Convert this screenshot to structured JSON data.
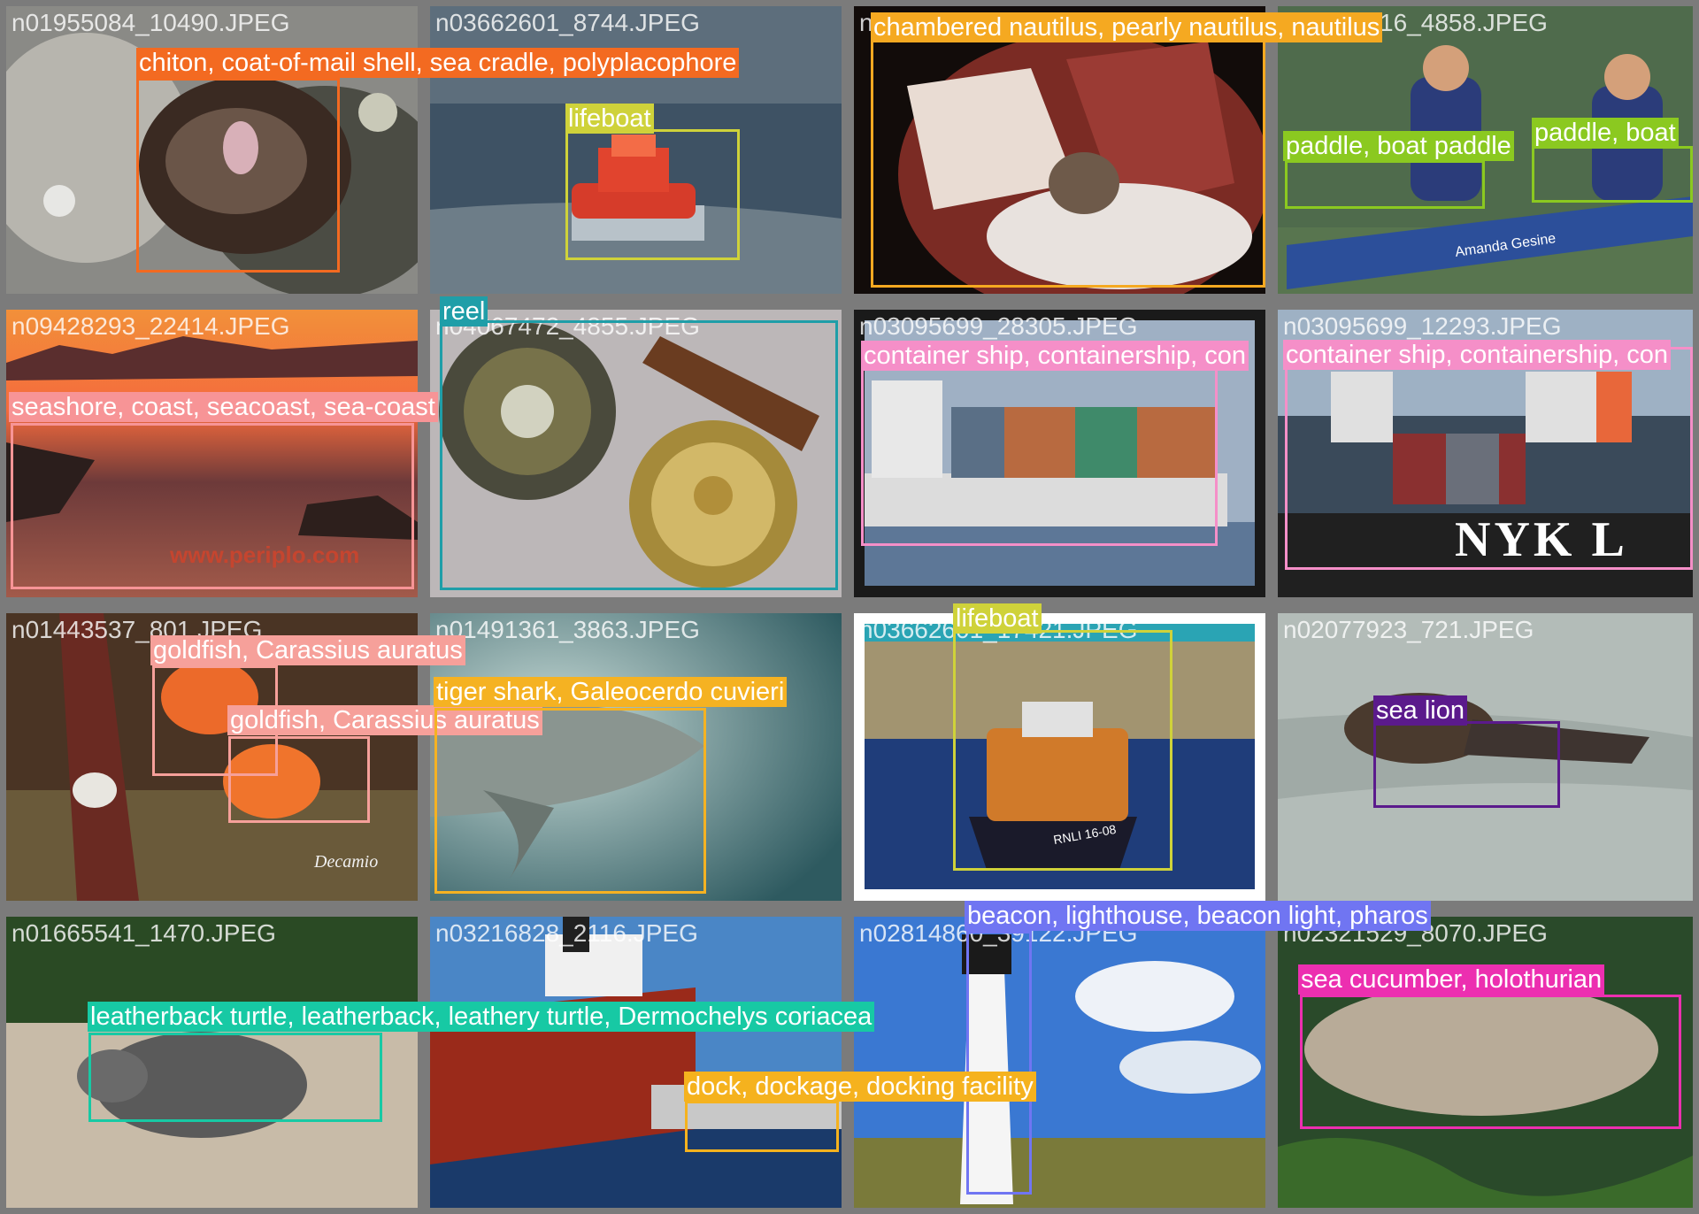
{
  "tiles": [
    {
      "file": "n01955084_10490.JPEG"
    },
    {
      "file": "n03662601_8744.JPEG"
    },
    {
      "file": "n01955084_8898.JPEG"
    },
    {
      "file": "n03873416_4858.JPEG"
    },
    {
      "file": "n09428293_22414.JPEG"
    },
    {
      "file": "n04067472_4855.JPEG"
    },
    {
      "file": "n03095699_28305.JPEG"
    },
    {
      "file": "n03095699_12293.JPEG"
    },
    {
      "file": "n01443537_801.JPEG"
    },
    {
      "file": "n01491361_3863.JPEG"
    },
    {
      "file": "n03662601_17421.JPEG"
    },
    {
      "file": "n02077923_721.JPEG"
    },
    {
      "file": "n01665541_1470.JPEG"
    },
    {
      "file": "n03216828_2116.JPEG"
    },
    {
      "file": "n02814860_39122.JPEG"
    },
    {
      "file": "n02321529_8070.JPEG"
    }
  ],
  "labels": {
    "chiton": "chiton, coat-of-mail shell, sea cradle, polyplacophore",
    "lifeboat_1": "lifeboat",
    "nautilus": "chambered nautilus, pearly nautilus, nautilus",
    "paddle_1": "paddle, boat paddle",
    "paddle_2": "paddle, boat",
    "seashore": "seashore, coast, seacoast, sea-coast",
    "reel": "reel",
    "container_1": "container ship, containership, con",
    "container_2": "container ship, containership, con",
    "goldfish_1": "goldfish, Carassius auratus",
    "goldfish_2": "goldfish, Carassius auratus",
    "tiger_shark": "tiger shark, Galeocerdo cuvieri",
    "lifeboat_2": "lifeboat",
    "sea_lion": "sea lion",
    "beacon": "beacon, lighthouse, beacon light, pharos",
    "turtle": "leatherback turtle, leatherback, leathery turtle, Dermochelys coriacea",
    "dock": "dock, dockage, docking facility",
    "sea_cucumber": "sea cucumber, holothurian"
  },
  "watermarks": {
    "periplo": "www.periplo.com",
    "decamio": "Decamio",
    "nyk": "NYK L",
    "amanda": "Amanda Gesine",
    "rnli": "RNLI 16-08"
  },
  "colors": {
    "chiton": "#f36a21",
    "lifeboat": "#cfd23a",
    "nautilus": "#f5a921",
    "paddle": "#8bc920",
    "seashore": "#f79496",
    "reel": "#1f9ea8",
    "container": "#f58fc8",
    "goldfish": "#f6a09a",
    "tiger_shark": "#f5b222",
    "sea_lion": "#5b1a8c",
    "beacon": "#7075f2",
    "turtle": "#17c9a4",
    "dock": "#f5b21e",
    "sea_cucumber": "#ec2fb0"
  }
}
